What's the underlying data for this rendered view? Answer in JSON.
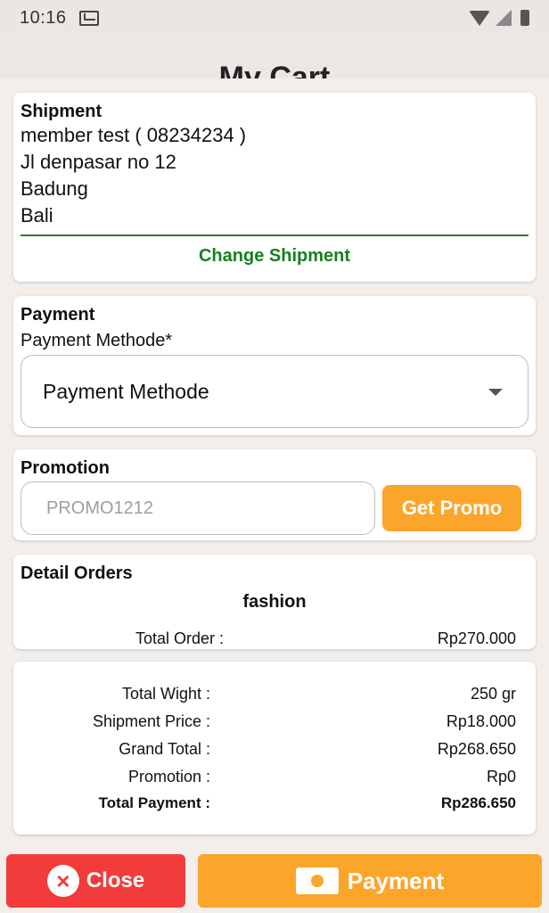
{
  "status_bar": {
    "time": "10:16"
  },
  "app_bar": {
    "title": "My Cart"
  },
  "shipment": {
    "title": "Shipment",
    "name_line": "member test ( 08234234 )",
    "address": "Jl denpasar no 12",
    "city": "Badung",
    "province": "Bali",
    "change_label": "Change Shipment"
  },
  "payment": {
    "title": "Payment",
    "field_label": "Payment Methode*",
    "selected": "Payment Methode"
  },
  "promotion": {
    "title": "Promotion",
    "placeholder": "PROMO1212",
    "button_label": "Get Promo"
  },
  "details": {
    "title": "Detail Orders",
    "category": "fashion",
    "total_order_label": "Total Order :",
    "total_order_value": "Rp270.000"
  },
  "summary": {
    "rows": [
      {
        "label": "Total Wight :",
        "value": "250 gr"
      },
      {
        "label": "Shipment Price :",
        "value": "Rp18.000"
      },
      {
        "label": "Grand Total :",
        "value": "Rp268.650"
      },
      {
        "label": "Promotion :",
        "value": "Rp0"
      },
      {
        "label": "Total Payment :",
        "value": "Rp286.650"
      }
    ]
  },
  "footer": {
    "close_label": "Close",
    "payment_label": "Payment"
  },
  "colors": {
    "accent_orange": "#fca52b",
    "close_red": "#f23b3b",
    "shipment_green": "#17801f"
  }
}
